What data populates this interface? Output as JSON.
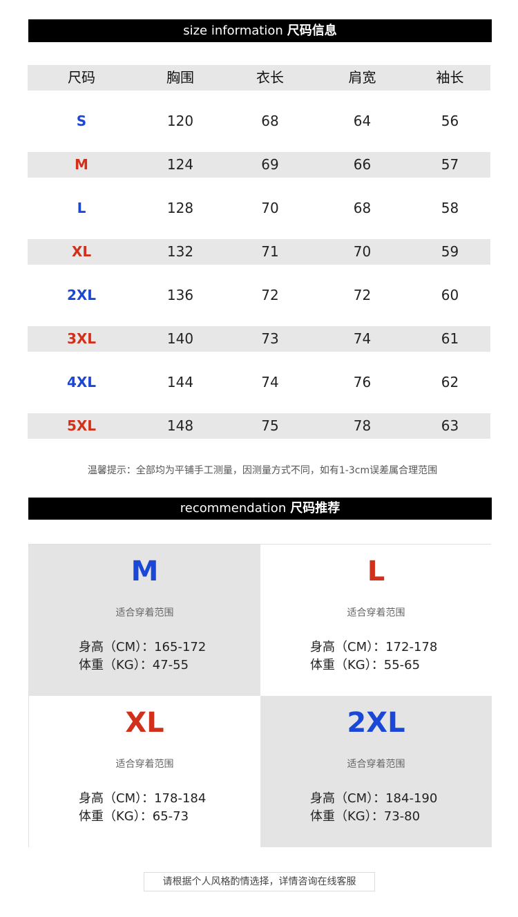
{
  "size_info": {
    "title_en": "size information",
    "title_zh": "尺码信息",
    "headers": [
      "尺码",
      "胸围",
      "衣长",
      "肩宽",
      "袖长"
    ],
    "rows": [
      {
        "size": "S",
        "chest": "120",
        "length": "68",
        "shoulder": "64",
        "sleeve": "56",
        "color": "#1a47d6"
      },
      {
        "size": "M",
        "chest": "124",
        "length": "69",
        "shoulder": "66",
        "sleeve": "57",
        "color": "#d1301b"
      },
      {
        "size": "L",
        "chest": "128",
        "length": "70",
        "shoulder": "68",
        "sleeve": "58",
        "color": "#1a47d6"
      },
      {
        "size": "XL",
        "chest": "132",
        "length": "71",
        "shoulder": "70",
        "sleeve": "59",
        "color": "#d1301b"
      },
      {
        "size": "2XL",
        "chest": "136",
        "length": "72",
        "shoulder": "72",
        "sleeve": "60",
        "color": "#1a47d6"
      },
      {
        "size": "3XL",
        "chest": "140",
        "length": "73",
        "shoulder": "74",
        "sleeve": "61",
        "color": "#d1301b"
      },
      {
        "size": "4XL",
        "chest": "144",
        "length": "74",
        "shoulder": "76",
        "sleeve": "62",
        "color": "#1a47d6"
      },
      {
        "size": "5XL",
        "chest": "148",
        "length": "75",
        "shoulder": "78",
        "sleeve": "63",
        "color": "#d1301b"
      }
    ],
    "tip": "温馨提示：全部均为平铺手工测量，因测量方式不同，如有1-3cm误差属合理范围"
  },
  "recommendation": {
    "title_en": "recommendation",
    "title_zh": "尺码推荐",
    "cards": [
      {
        "size": "M",
        "fit_label": "适合穿着范围",
        "height": "身高（CM）：165-172",
        "weight": "体重（KG）：47-55",
        "color": "#1a47d6"
      },
      {
        "size": "L",
        "fit_label": "适合穿着范围",
        "height": "身高（CM）：172-178",
        "weight": "体重（KG）：55-65",
        "color": "#d1301b"
      },
      {
        "size": "XL",
        "fit_label": "适合穿着范围",
        "height": "身高（CM）：178-184",
        "weight": "体重（KG）：65-73",
        "color": "#d1301b"
      },
      {
        "size": "2XL",
        "fit_label": "适合穿着范围",
        "height": "身高（CM）：184-190",
        "weight": "体重（KG）：73-80",
        "color": "#1a47d6"
      }
    ],
    "footer": "请根据个人风格酌情选择，详情咨询在线客服"
  }
}
